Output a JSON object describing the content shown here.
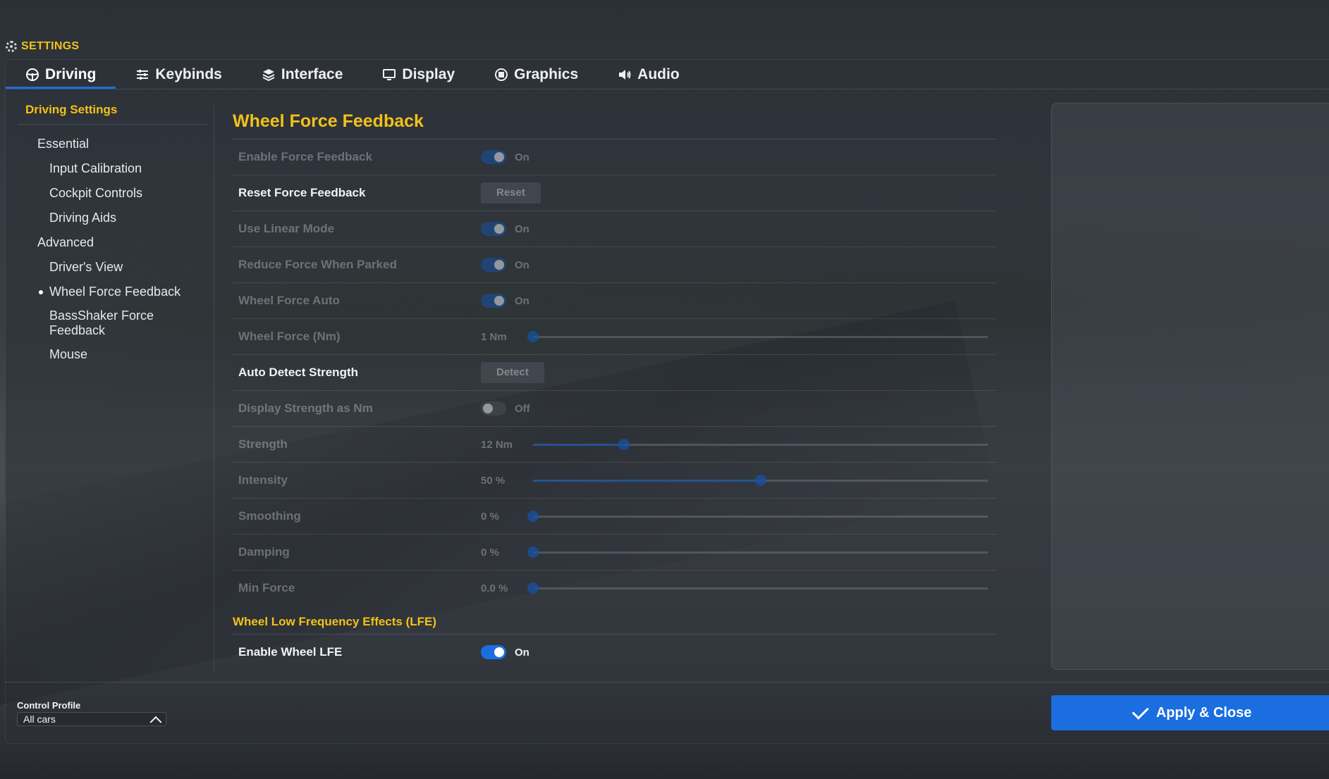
{
  "header": {
    "title": "SETTINGS",
    "icon": "gear-icon"
  },
  "tabs": [
    {
      "label": "Driving",
      "icon": "steering-wheel-icon",
      "active": true
    },
    {
      "label": "Keybinds",
      "icon": "sliders-icon",
      "active": false
    },
    {
      "label": "Interface",
      "icon": "layers-icon",
      "active": false
    },
    {
      "label": "Display",
      "icon": "monitor-icon",
      "active": false
    },
    {
      "label": "Graphics",
      "icon": "chip-icon",
      "active": false
    },
    {
      "label": "Audio",
      "icon": "speaker-icon",
      "active": false
    }
  ],
  "sidebar": {
    "heading": "Driving Settings",
    "items": [
      {
        "label": "Essential",
        "level": 1
      },
      {
        "label": "Input Calibration",
        "level": 2
      },
      {
        "label": "Cockpit Controls",
        "level": 2
      },
      {
        "label": "Driving Aids",
        "level": 2
      },
      {
        "label": "Advanced",
        "level": 1
      },
      {
        "label": "Driver's View",
        "level": 2
      },
      {
        "label": "Wheel Force Feedback",
        "level": 2,
        "active": true
      },
      {
        "label": "BassShaker Force Feedback",
        "level": 2
      },
      {
        "label": "Mouse",
        "level": 2
      }
    ]
  },
  "main": {
    "section_title": "Wheel Force Feedback",
    "rows": {
      "enable_ffb": {
        "label": "Enable Force Feedback",
        "state": "On"
      },
      "reset_ffb": {
        "label": "Reset Force Feedback",
        "button": "Reset"
      },
      "linear_mode": {
        "label": "Use Linear Mode",
        "state": "On"
      },
      "reduce_parked": {
        "label": "Reduce Force When Parked",
        "state": "On"
      },
      "wheel_force_auto": {
        "label": "Wheel Force Auto",
        "state": "On"
      },
      "wheel_force_nm": {
        "label": "Wheel Force (Nm)",
        "value": "1 Nm",
        "fraction": 0.0
      },
      "auto_detect": {
        "label": "Auto Detect Strength",
        "button": "Detect"
      },
      "display_nm": {
        "label": "Display Strength as Nm",
        "state": "Off"
      },
      "strength": {
        "label": "Strength",
        "value": "12 Nm",
        "fraction": 0.2
      },
      "intensity": {
        "label": "Intensity",
        "value": "50 %",
        "fraction": 0.5
      },
      "smoothing": {
        "label": "Smoothing",
        "value": "0 %",
        "fraction": 0.0
      },
      "damping": {
        "label": "Damping",
        "value": "0 %",
        "fraction": 0.0
      },
      "min_force": {
        "label": "Min Force",
        "value": "0.0 %",
        "fraction": 0.0
      }
    },
    "lfe_title": "Wheel Low Frequency Effects (LFE)",
    "lfe": {
      "label": "Enable Wheel LFE",
      "state": "On"
    }
  },
  "footer": {
    "profile_label": "Control Profile",
    "profile_value": "All cars",
    "apply_label": "Apply & Close"
  },
  "colors": {
    "accent": "#1a6ee0",
    "heading": "#f2c21a"
  }
}
